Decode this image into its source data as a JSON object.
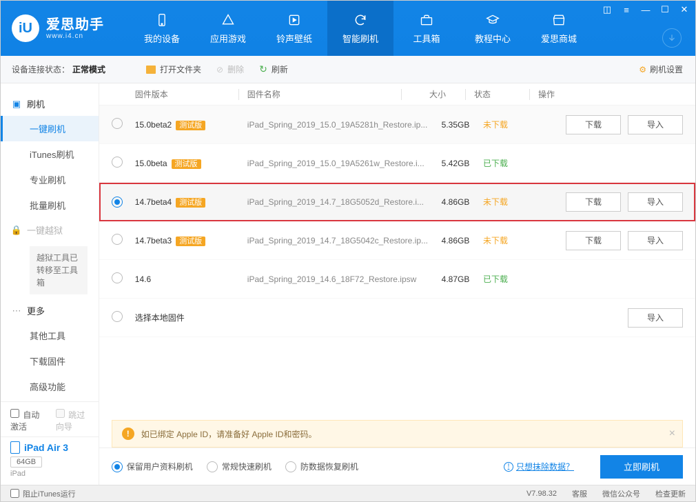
{
  "brand": {
    "main": "爱思助手",
    "sub": "www.i4.cn",
    "logo_letter": "iU"
  },
  "nav": {
    "items": [
      {
        "label": "我的设备",
        "icon": "phone-icon"
      },
      {
        "label": "应用游戏",
        "icon": "apps-icon"
      },
      {
        "label": "铃声壁纸",
        "icon": "music-icon"
      },
      {
        "label": "智能刷机",
        "icon": "refresh-icon",
        "active": true
      },
      {
        "label": "工具箱",
        "icon": "toolbox-icon"
      },
      {
        "label": "教程中心",
        "icon": "graduate-icon"
      },
      {
        "label": "爱思商城",
        "icon": "store-icon"
      }
    ]
  },
  "status_bar": {
    "label": "设备连接状态：",
    "value": "正常模式"
  },
  "toolbar": {
    "open_folder": "打开文件夹",
    "delete": "删除",
    "refresh": "刷新",
    "settings": "刷机设置"
  },
  "sidebar": {
    "group1_title": "刷机",
    "items1": [
      "一键刷机",
      "iTunes刷机",
      "专业刷机",
      "批量刷机"
    ],
    "jailbreak_title": "一键越狱",
    "jailbreak_notice": "越狱工具已转移至工具箱",
    "group2_title": "更多",
    "items2": [
      "其他工具",
      "下载固件",
      "高级功能"
    ],
    "auto_activate": "自动激活",
    "skip_guide": "跳过向导",
    "device": {
      "name": "iPad Air 3",
      "capacity": "64GB",
      "type": "iPad"
    }
  },
  "columns": {
    "version": "固件版本",
    "name": "固件名称",
    "size": "大小",
    "status": "状态",
    "ops": "操作"
  },
  "rows": [
    {
      "version": "15.0beta2",
      "beta": "测试版",
      "name": "iPad_Spring_2019_15.0_19A5281h_Restore.ip...",
      "size": "5.35GB",
      "status": "未下载",
      "status_class": "st-orange",
      "ops": [
        "下载",
        "导入"
      ],
      "alt": true
    },
    {
      "version": "15.0beta",
      "beta": "测试版",
      "name": "iPad_Spring_2019_15.0_19A5261w_Restore.i...",
      "size": "5.42GB",
      "status": "已下载",
      "status_class": "st-green",
      "ops": []
    },
    {
      "version": "14.7beta4",
      "beta": "测试版",
      "name": "iPad_Spring_2019_14.7_18G5052d_Restore.i...",
      "size": "4.86GB",
      "status": "未下载",
      "status_class": "st-orange",
      "ops": [
        "下载",
        "导入"
      ],
      "highlight": true,
      "checked": true
    },
    {
      "version": "14.7beta3",
      "beta": "测试版",
      "name": "iPad_Spring_2019_14.7_18G5042c_Restore.ip...",
      "size": "4.86GB",
      "status": "未下载",
      "status_class": "st-orange",
      "ops": [
        "下载",
        "导入"
      ]
    },
    {
      "version": "14.6",
      "beta": "",
      "name": "iPad_Spring_2019_14.6_18F72_Restore.ipsw",
      "size": "4.87GB",
      "status": "已下载",
      "status_class": "st-green",
      "ops": []
    },
    {
      "version": "选择本地固件",
      "beta": "",
      "name": "",
      "size": "",
      "status": "",
      "status_class": "",
      "ops": [
        "导入"
      ],
      "local": true
    }
  ],
  "banner": {
    "text": "如已绑定 Apple ID，请准备好 Apple ID和密码。"
  },
  "flash_options": {
    "o1": "保留用户资料刷机",
    "o2": "常规快速刷机",
    "o3": "防数据恢复刷机",
    "link": "只想抹除数据？",
    "action": "立即刷机"
  },
  "footer": {
    "block_itunes": "阻止iTunes运行",
    "version": "V7.98.32",
    "service": "客服",
    "wechat": "微信公众号",
    "update": "检查更新"
  }
}
